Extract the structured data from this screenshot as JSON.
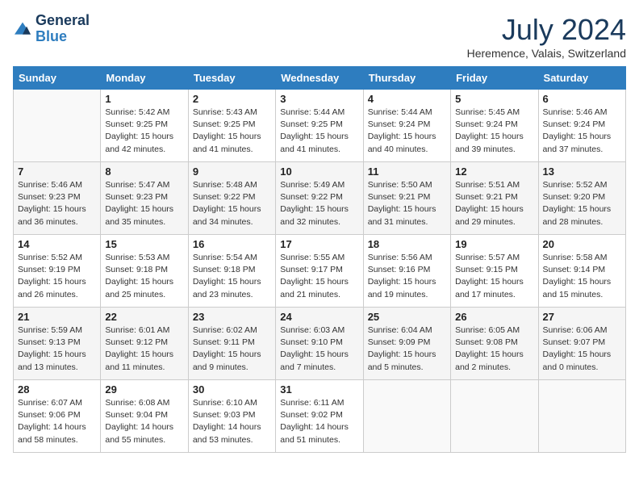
{
  "logo": {
    "line1": "General",
    "line2": "Blue"
  },
  "title": "July 2024",
  "location": "Heremence, Valais, Switzerland",
  "weekdays": [
    "Sunday",
    "Monday",
    "Tuesday",
    "Wednesday",
    "Thursday",
    "Friday",
    "Saturday"
  ],
  "weeks": [
    [
      {
        "day": null
      },
      {
        "day": 1,
        "sunrise": "5:42 AM",
        "sunset": "9:25 PM",
        "daylight": "15 hours and 42 minutes."
      },
      {
        "day": 2,
        "sunrise": "5:43 AM",
        "sunset": "9:25 PM",
        "daylight": "15 hours and 41 minutes."
      },
      {
        "day": 3,
        "sunrise": "5:44 AM",
        "sunset": "9:25 PM",
        "daylight": "15 hours and 41 minutes."
      },
      {
        "day": 4,
        "sunrise": "5:44 AM",
        "sunset": "9:24 PM",
        "daylight": "15 hours and 40 minutes."
      },
      {
        "day": 5,
        "sunrise": "5:45 AM",
        "sunset": "9:24 PM",
        "daylight": "15 hours and 39 minutes."
      },
      {
        "day": 6,
        "sunrise": "5:46 AM",
        "sunset": "9:24 PM",
        "daylight": "15 hours and 37 minutes."
      }
    ],
    [
      {
        "day": 7,
        "sunrise": "5:46 AM",
        "sunset": "9:23 PM",
        "daylight": "15 hours and 36 minutes."
      },
      {
        "day": 8,
        "sunrise": "5:47 AM",
        "sunset": "9:23 PM",
        "daylight": "15 hours and 35 minutes."
      },
      {
        "day": 9,
        "sunrise": "5:48 AM",
        "sunset": "9:22 PM",
        "daylight": "15 hours and 34 minutes."
      },
      {
        "day": 10,
        "sunrise": "5:49 AM",
        "sunset": "9:22 PM",
        "daylight": "15 hours and 32 minutes."
      },
      {
        "day": 11,
        "sunrise": "5:50 AM",
        "sunset": "9:21 PM",
        "daylight": "15 hours and 31 minutes."
      },
      {
        "day": 12,
        "sunrise": "5:51 AM",
        "sunset": "9:21 PM",
        "daylight": "15 hours and 29 minutes."
      },
      {
        "day": 13,
        "sunrise": "5:52 AM",
        "sunset": "9:20 PM",
        "daylight": "15 hours and 28 minutes."
      }
    ],
    [
      {
        "day": 14,
        "sunrise": "5:52 AM",
        "sunset": "9:19 PM",
        "daylight": "15 hours and 26 minutes."
      },
      {
        "day": 15,
        "sunrise": "5:53 AM",
        "sunset": "9:18 PM",
        "daylight": "15 hours and 25 minutes."
      },
      {
        "day": 16,
        "sunrise": "5:54 AM",
        "sunset": "9:18 PM",
        "daylight": "15 hours and 23 minutes."
      },
      {
        "day": 17,
        "sunrise": "5:55 AM",
        "sunset": "9:17 PM",
        "daylight": "15 hours and 21 minutes."
      },
      {
        "day": 18,
        "sunrise": "5:56 AM",
        "sunset": "9:16 PM",
        "daylight": "15 hours and 19 minutes."
      },
      {
        "day": 19,
        "sunrise": "5:57 AM",
        "sunset": "9:15 PM",
        "daylight": "15 hours and 17 minutes."
      },
      {
        "day": 20,
        "sunrise": "5:58 AM",
        "sunset": "9:14 PM",
        "daylight": "15 hours and 15 minutes."
      }
    ],
    [
      {
        "day": 21,
        "sunrise": "5:59 AM",
        "sunset": "9:13 PM",
        "daylight": "15 hours and 13 minutes."
      },
      {
        "day": 22,
        "sunrise": "6:01 AM",
        "sunset": "9:12 PM",
        "daylight": "15 hours and 11 minutes."
      },
      {
        "day": 23,
        "sunrise": "6:02 AM",
        "sunset": "9:11 PM",
        "daylight": "15 hours and 9 minutes."
      },
      {
        "day": 24,
        "sunrise": "6:03 AM",
        "sunset": "9:10 PM",
        "daylight": "15 hours and 7 minutes."
      },
      {
        "day": 25,
        "sunrise": "6:04 AM",
        "sunset": "9:09 PM",
        "daylight": "15 hours and 5 minutes."
      },
      {
        "day": 26,
        "sunrise": "6:05 AM",
        "sunset": "9:08 PM",
        "daylight": "15 hours and 2 minutes."
      },
      {
        "day": 27,
        "sunrise": "6:06 AM",
        "sunset": "9:07 PM",
        "daylight": "15 hours and 0 minutes."
      }
    ],
    [
      {
        "day": 28,
        "sunrise": "6:07 AM",
        "sunset": "9:06 PM",
        "daylight": "14 hours and 58 minutes."
      },
      {
        "day": 29,
        "sunrise": "6:08 AM",
        "sunset": "9:04 PM",
        "daylight": "14 hours and 55 minutes."
      },
      {
        "day": 30,
        "sunrise": "6:10 AM",
        "sunset": "9:03 PM",
        "daylight": "14 hours and 53 minutes."
      },
      {
        "day": 31,
        "sunrise": "6:11 AM",
        "sunset": "9:02 PM",
        "daylight": "14 hours and 51 minutes."
      },
      {
        "day": null
      },
      {
        "day": null
      },
      {
        "day": null
      }
    ]
  ]
}
